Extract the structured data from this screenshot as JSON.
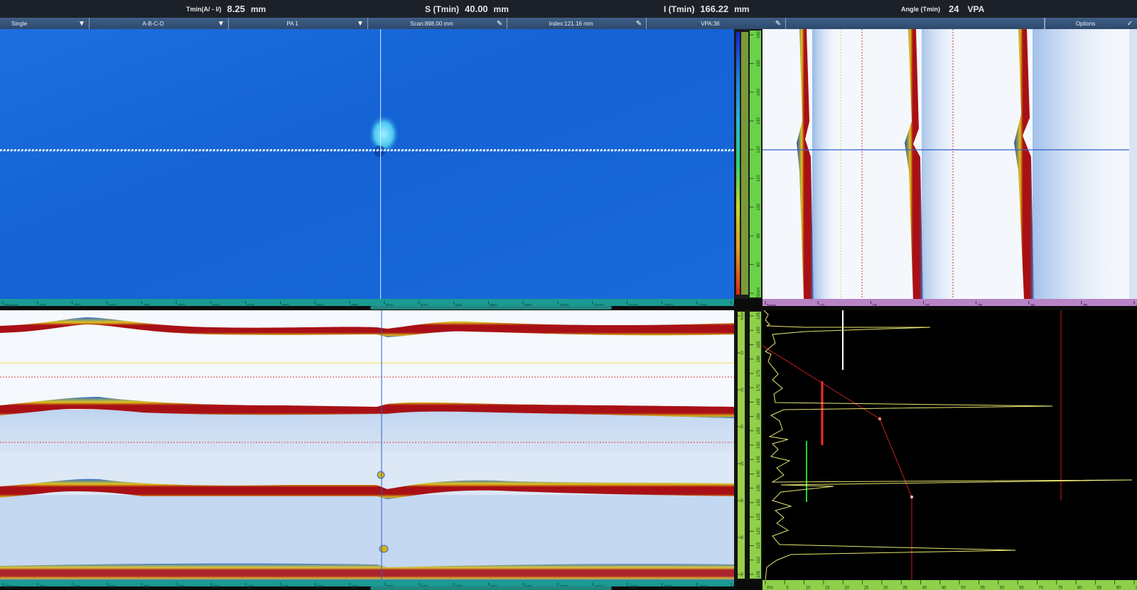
{
  "readout": {
    "tmin_label": "Tmin(A/ - I/)",
    "tmin_value": "8.25",
    "tmin_unit": "mm",
    "s_label": "S (Tmin)",
    "s_value": "40.00",
    "s_unit": "mm",
    "i_label": "I (Tmin)",
    "i_value": "166.22",
    "i_unit": "mm",
    "angle_label": "Angle (Tmin)",
    "angle_value": "24",
    "angle_unit": "VPA"
  },
  "toolbar": {
    "mode": "Single",
    "layout": "A-B-C-D",
    "group": "PA 1",
    "scan": "Scan:898.00 mm",
    "index": "Index:121.16 mm",
    "vpa": "VPA:36",
    "options": "Options"
  },
  "rulers": {
    "scan_ticks": [
      "680mm",
      "700",
      "720",
      "740",
      "760",
      "780",
      "800",
      "820",
      "840",
      "860",
      "880",
      "900",
      "920",
      "940",
      "960",
      "980",
      "1000",
      "1020",
      "1040",
      "1060",
      "1080",
      "1100"
    ],
    "sview_ticks": [
      "5mm",
      "10",
      "15",
      "20",
      "25",
      "30",
      "35",
      "40"
    ],
    "ascan_amp_ticks": [
      "0%",
      "5",
      "10",
      "15",
      "20",
      "25",
      "30",
      "35",
      "40",
      "45",
      "50",
      "55",
      "60",
      "65",
      "70",
      "75",
      "80",
      "85",
      "90",
      "95"
    ],
    "cscan_index_ticks": [
      "160",
      "150",
      "140",
      "130",
      "120",
      "110",
      "100",
      "90",
      "80",
      "70mm"
    ],
    "bscan_depth_ticks": [
      "195",
      "190",
      "185",
      "180",
      "175",
      "170",
      "165",
      "160",
      "155",
      "150",
      "145",
      "140",
      "135",
      "130",
      "125",
      "120",
      "115",
      "110",
      "105"
    ],
    "ascan_depth_ticks": [
      "5mm",
      "10",
      "15",
      "20",
      "25",
      "30",
      "35",
      "40"
    ]
  },
  "colors": {
    "cscan_bg": "#1565d8",
    "amplitude_high": "#a81016",
    "gate_a": "#ff2a2a",
    "gate_b": "#2ad32a",
    "gate_i": "#ffffff",
    "ascan_trace": "#e8e870",
    "toolbar": "#34557b"
  },
  "icons": {
    "dropdown": "dropdown-arrow-icon",
    "edit": "pencil-icon",
    "options": "options-check-icon"
  }
}
